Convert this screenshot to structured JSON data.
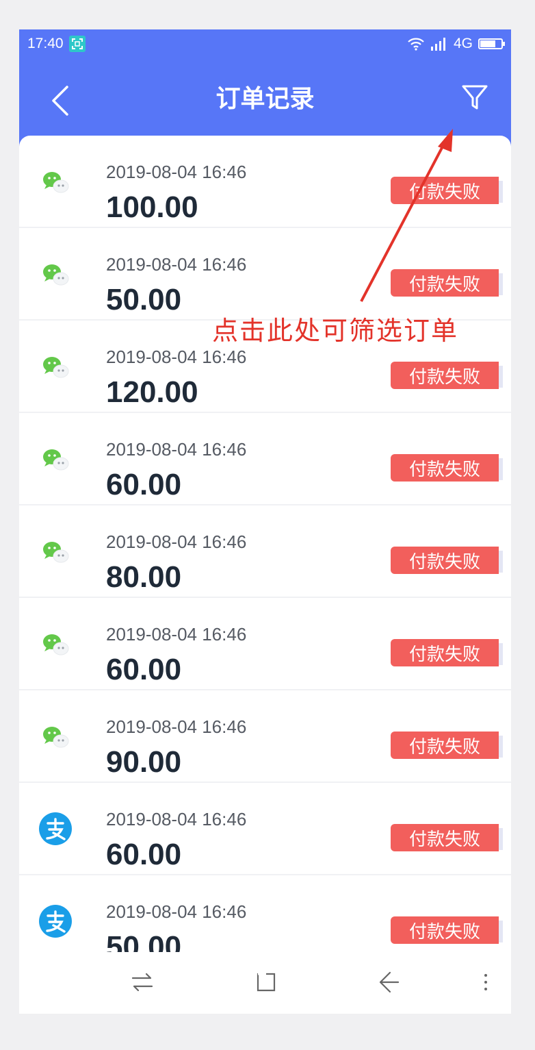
{
  "status_bar": {
    "time": "17:40",
    "network": "4G",
    "icons": [
      "screenshot-icon",
      "wifi-icon",
      "signal-icon",
      "battery-icon"
    ]
  },
  "header": {
    "title": "订单记录",
    "back_icon": "chevron-left-icon",
    "filter_icon": "filter-icon",
    "background_color": "#5776f7"
  },
  "orders": [
    {
      "method": "wechat",
      "datetime": "2019-08-04 16:46",
      "amount": "100.00",
      "status": "付款失败"
    },
    {
      "method": "wechat",
      "datetime": "2019-08-04 16:46",
      "amount": "50.00",
      "status": "付款失败"
    },
    {
      "method": "wechat",
      "datetime": "2019-08-04 16:46",
      "amount": "120.00",
      "status": "付款失败"
    },
    {
      "method": "wechat",
      "datetime": "2019-08-04 16:46",
      "amount": "60.00",
      "status": "付款失败"
    },
    {
      "method": "wechat",
      "datetime": "2019-08-04 16:46",
      "amount": "80.00",
      "status": "付款失败"
    },
    {
      "method": "wechat",
      "datetime": "2019-08-04 16:46",
      "amount": "60.00",
      "status": "付款失败"
    },
    {
      "method": "wechat",
      "datetime": "2019-08-04 16:46",
      "amount": "90.00",
      "status": "付款失败"
    },
    {
      "method": "alipay",
      "datetime": "2019-08-04 16:46",
      "amount": "60.00",
      "status": "付款失败"
    },
    {
      "method": "alipay",
      "datetime": "2019-08-04 16:46",
      "amount": "50.00",
      "status": "付款失败"
    }
  ],
  "annotation": {
    "text": "点击此处可筛选订单",
    "color": "#e3332a"
  },
  "colors": {
    "status_failed": "#f25f5c",
    "wechat": "#63c84a",
    "alipay": "#1a9ee8"
  },
  "navbar": {
    "icons": [
      "switch-icon",
      "home-square-icon",
      "back-arrow-icon",
      "menu-icon"
    ]
  }
}
